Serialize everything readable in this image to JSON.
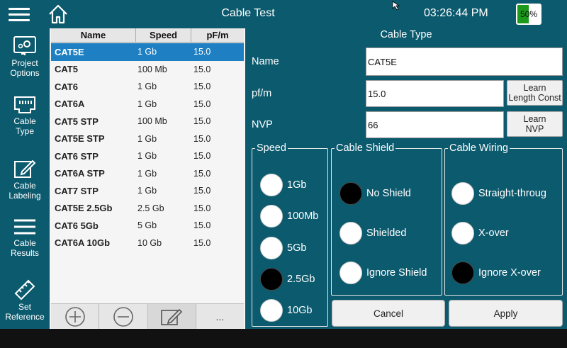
{
  "header": {
    "title": "Cable Test",
    "clock": "03:26:44 PM",
    "battery_pct": "50%",
    "battery_level": 0.5,
    "menu_icon": "hamburger-icon",
    "home_icon": "home-icon"
  },
  "sidebar": {
    "items": [
      {
        "icon": "gear-network-icon",
        "label": "Project\nOptions"
      },
      {
        "icon": "ethernet-port-icon",
        "label": "Cable\nType"
      },
      {
        "icon": "pencil-edit-icon",
        "label": "Cable\nLabeling"
      },
      {
        "icon": "list-lines-icon",
        "label": "Cable\nResults"
      },
      {
        "icon": "ruler-icon",
        "label": "Set\nReference"
      }
    ]
  },
  "table": {
    "headers": [
      "Name",
      "Speed",
      "pF/m"
    ],
    "rows": [
      {
        "name": "CAT5E",
        "speed": "1 Gb",
        "pfm": "15.0",
        "selected": true
      },
      {
        "name": "CAT5",
        "speed": "100 Mb",
        "pfm": "15.0"
      },
      {
        "name": "CAT6",
        "speed": "1 Gb",
        "pfm": "15.0"
      },
      {
        "name": "CAT6A",
        "speed": "1 Gb",
        "pfm": "15.0"
      },
      {
        "name": "CAT5 STP",
        "speed": "100 Mb",
        "pfm": "15.0"
      },
      {
        "name": "CAT5E STP",
        "speed": "1 Gb",
        "pfm": "15.0"
      },
      {
        "name": "CAT6 STP",
        "speed": "1 Gb",
        "pfm": "15.0"
      },
      {
        "name": "CAT6A STP",
        "speed": "1 Gb",
        "pfm": "15.0"
      },
      {
        "name": "CAT7 STP",
        "speed": "1 Gb",
        "pfm": "15.0"
      },
      {
        "name": "CAT5E 2.5Gb",
        "speed": "2.5 Gb",
        "pfm": "15.0"
      },
      {
        "name": "CAT6 5Gb",
        "speed": "5 Gb",
        "pfm": "15.0"
      },
      {
        "name": "CAT6A 10Gb",
        "speed": "10 Gb",
        "pfm": "15.0"
      }
    ],
    "toolbar": {
      "add_icon": "plus-circle-icon",
      "remove_icon": "minus-circle-icon",
      "edit_icon": "edit-icon",
      "more_label": "..."
    }
  },
  "cable_type": {
    "title": "Cable Type",
    "name_label": "Name",
    "name_value": "CAT5E",
    "pfm_label": "pf/m",
    "pfm_value": "15.0",
    "nvp_label": "NVP",
    "nvp_value": "66",
    "learn_length_label": "Learn\nLength Const",
    "learn_nvp_label": "Learn\nNVP"
  },
  "speed": {
    "legend": "Speed",
    "options": [
      {
        "label": "1Gb",
        "selected": false
      },
      {
        "label": "100Mb",
        "selected": false
      },
      {
        "label": "5Gb",
        "selected": false
      },
      {
        "label": "2.5Gb",
        "selected": true
      },
      {
        "label": "10Gb",
        "selected": false
      }
    ]
  },
  "shield": {
    "legend": "Cable Shield",
    "options": [
      {
        "label": "No Shield",
        "selected": true
      },
      {
        "label": "Shielded",
        "selected": false
      },
      {
        "label": "Ignore Shield",
        "selected": false
      }
    ]
  },
  "wiring": {
    "legend": "Cable Wiring",
    "options": [
      {
        "label": "Straight-throug",
        "selected": false
      },
      {
        "label": "X-over",
        "selected": false
      },
      {
        "label": "Ignore X-over",
        "selected": true
      }
    ]
  },
  "actions": {
    "cancel_label": "Cancel",
    "apply_label": "Apply"
  },
  "colors": {
    "teal": "#0c5a6e",
    "selection": "#1e7fc2",
    "battery_green": "#1c9a1c"
  }
}
